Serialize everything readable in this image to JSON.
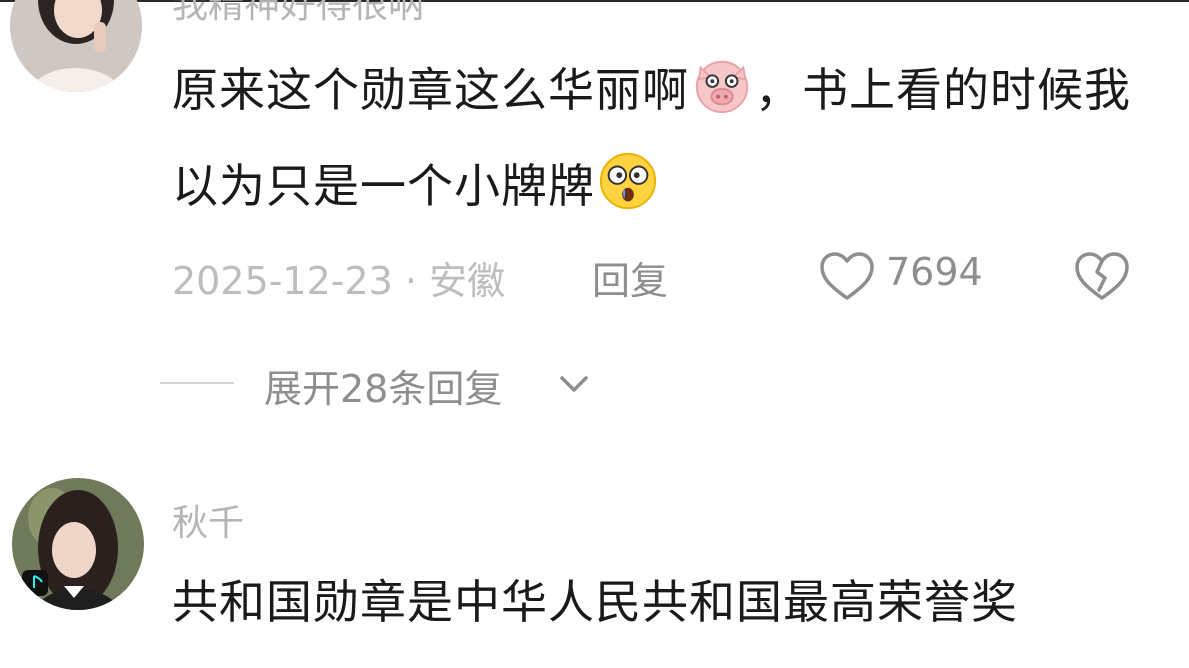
{
  "comments": [
    {
      "username": "我精神好得很呐",
      "text_part1": "原来这个勋章这么华丽啊",
      "emoji1": "pig-face-icon",
      "text_part2": "，书上看的时候我以为只是一个小牌牌",
      "emoji2": "shocked-face-icon",
      "date_location": "2025-12-23 · 安徽",
      "reply_label": "回复",
      "like_count": "7694",
      "expand_label": "展开28条回复"
    },
    {
      "username": "秋千",
      "text": "共和国勋章是中华人民共和国最高荣誉奖"
    }
  ],
  "colors": {
    "text": "#1a1a1a",
    "muted": "#bdbdbd",
    "secondary": "#8e8e8e",
    "divider": "#d6d6d6"
  }
}
